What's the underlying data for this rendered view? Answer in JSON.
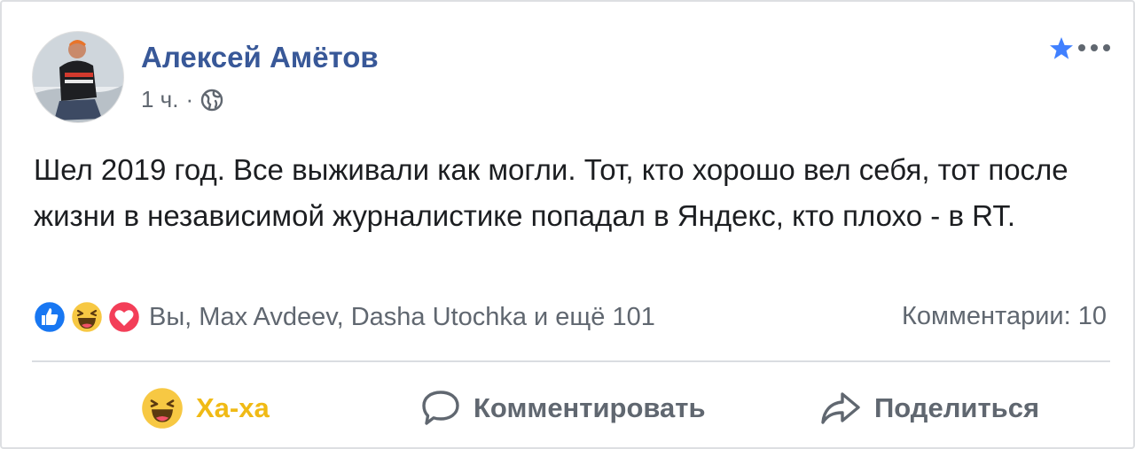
{
  "post": {
    "author_name": "Алексей Амётов",
    "timestamp": "1 ч.",
    "separator": "·",
    "privacy_icon": "globe-icon",
    "text": "Шел 2019 год. Все выживали как могли. Тот, кто хорошо вел себя, тот после жизни в независимой журналистике попадал в Яндекс, кто плохо - в RT."
  },
  "header_icons": [
    "star-icon",
    "more-options-icon"
  ],
  "reactions": {
    "icons": [
      "like-reaction-icon",
      "haha-reaction-icon",
      "love-reaction-icon"
    ],
    "names": "Вы, Max Avdeev, Dasha Utochka и ещё 101",
    "comments_label": "Комментарии: 10"
  },
  "actions": {
    "haha_label": "Ха-ха",
    "comment_label": "Комментировать",
    "share_label": "Поделиться"
  },
  "colors": {
    "author": "#385898",
    "secondary_text": "#606770",
    "haha_active": "#f0ba15",
    "like_blue": "#1877f2",
    "love_red": "#f33e58",
    "star_blue": "#4080ff"
  }
}
